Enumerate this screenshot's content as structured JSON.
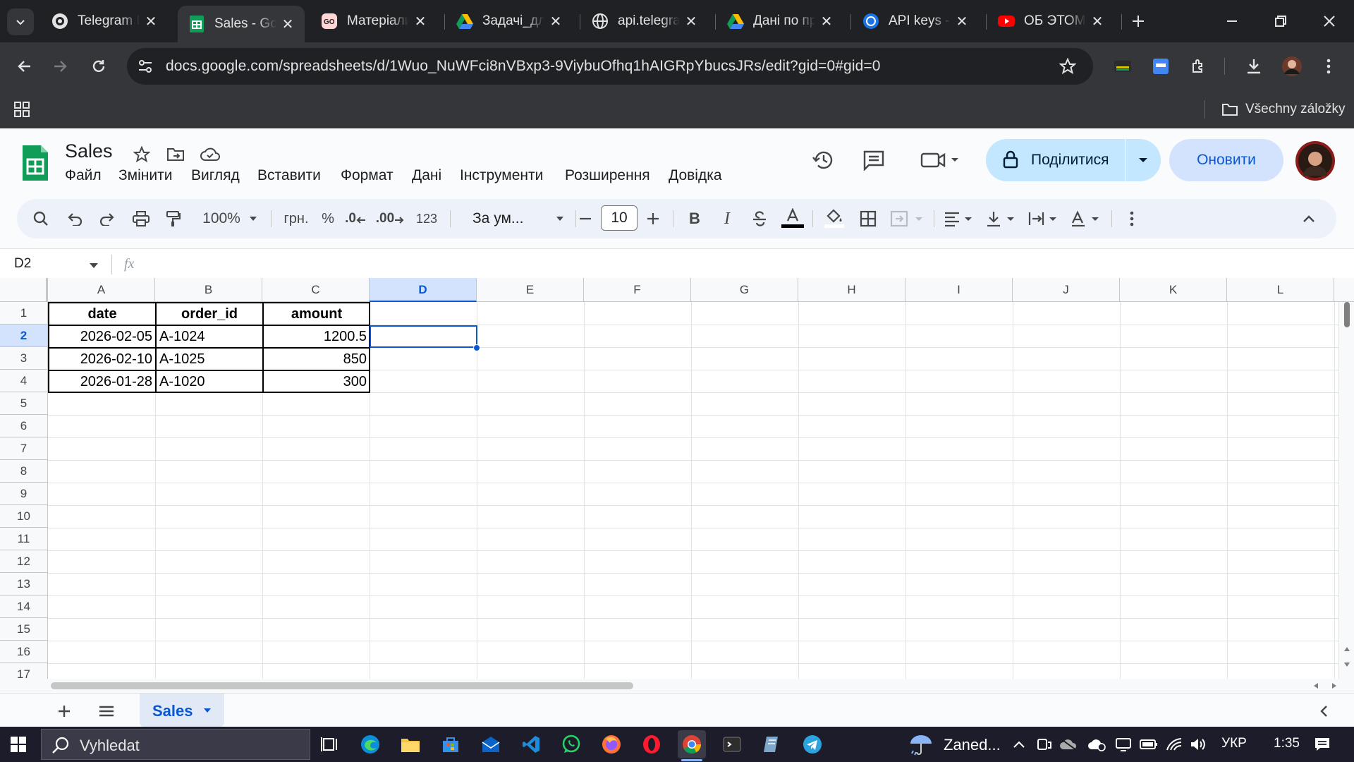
{
  "browser": {
    "tabs": [
      {
        "title": "Telegram B",
        "favicon": "telegram-bot-icon",
        "active": false
      },
      {
        "title": "Sales - Goo",
        "favicon": "google-sheets-icon",
        "active": true
      },
      {
        "title": "Матеріали",
        "favicon": "goit-icon",
        "active": false
      },
      {
        "title": "Задачі_для",
        "favicon": "google-drive-icon",
        "active": false
      },
      {
        "title": "api.telegra",
        "favicon": "globe-icon",
        "active": false
      },
      {
        "title": "Дані по пр",
        "favicon": "google-drive-icon",
        "active": false
      },
      {
        "title": "API keys -",
        "favicon": "openai-icon",
        "active": false
      },
      {
        "title": "ОБ ЭТОМ",
        "favicon": "youtube-icon",
        "active": false
      }
    ],
    "url": "docs.google.com/spreadsheets/d/1Wuo_NuWFci8nVBxp3-9ViybuOfhq1hAIGRpYbucsJRs/edit?gid=0#gid=0",
    "bookmarks_folder": "Všechny záložky"
  },
  "sheets": {
    "doc_title": "Sales",
    "menu": [
      "Файл",
      "Змінити",
      "Вигляд",
      "Вставити",
      "Формат",
      "Дані",
      "Інструменти",
      "Розширення",
      "Довідка"
    ],
    "share_label": "Поділитися",
    "update_label": "Оновити",
    "toolbar": {
      "zoom": "100%",
      "currency": "грн.",
      "percent": "%",
      "decrease_decimal": ".0",
      "increase_decimal": ".00",
      "number_format": "123",
      "font": "За ум...",
      "font_size": "10"
    },
    "name_box": "D2",
    "fx_label": "fx",
    "columns": [
      "A",
      "B",
      "C",
      "D",
      "E",
      "F",
      "G",
      "H",
      "I",
      "J",
      "K",
      "L"
    ],
    "selected_column": "D",
    "rows": [
      "1",
      "2",
      "3",
      "4",
      "5",
      "6",
      "7",
      "8",
      "9",
      "10",
      "11",
      "12",
      "13",
      "14",
      "15",
      "16",
      "17"
    ],
    "selected_row": "2",
    "headers": [
      "date",
      "order_id",
      "amount"
    ],
    "data": [
      [
        "2026-02-05",
        "A-1024",
        "1200.5"
      ],
      [
        "2026-02-10",
        "A-1025",
        "850"
      ],
      [
        "2026-01-28",
        "A-1020",
        "300"
      ]
    ],
    "sheet_tab": "Sales"
  },
  "taskbar": {
    "search_placeholder": "Vyhledat",
    "weather": "Zaned...",
    "language": "УКР",
    "time": "1:35"
  },
  "colors": {
    "accent": "#0b57d0",
    "share_bg": "#c2e7ff",
    "sheets_green": "#0f9d58"
  }
}
